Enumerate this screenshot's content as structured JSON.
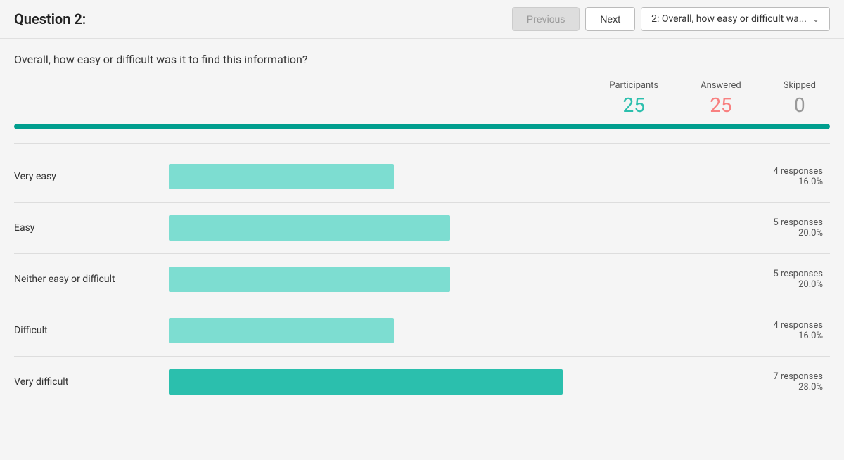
{
  "header": {
    "question_title": "Question 2:",
    "prev_label": "Previous",
    "next_label": "Next",
    "dropdown_text": "2: Overall, how easy or difficult wa..."
  },
  "question": {
    "text": "Overall, how easy or difficult was it to find this information?",
    "stats": {
      "participants_label": "Participants",
      "answered_label": "Answered",
      "skipped_label": "Skipped",
      "participants_value": "25",
      "answered_value": "25",
      "skipped_value": "0"
    },
    "progress_pct": 100
  },
  "chart": {
    "rows": [
      {
        "label": "Very easy",
        "bar_pct": 16,
        "response_count": "4 responses",
        "response_pct": "16.0%",
        "dark": false
      },
      {
        "label": "Easy",
        "bar_pct": 20,
        "response_count": "5 responses",
        "response_pct": "20.0%",
        "dark": false
      },
      {
        "label": "Neither easy or difficult",
        "bar_pct": 20,
        "response_count": "5 responses",
        "response_pct": "20.0%",
        "dark": false
      },
      {
        "label": "Difficult",
        "bar_pct": 16,
        "response_count": "4 responses",
        "response_pct": "16.0%",
        "dark": false
      },
      {
        "label": "Very difficult",
        "bar_pct": 28,
        "response_count": "7 responses",
        "response_pct": "28.0%",
        "dark": true
      }
    ]
  }
}
